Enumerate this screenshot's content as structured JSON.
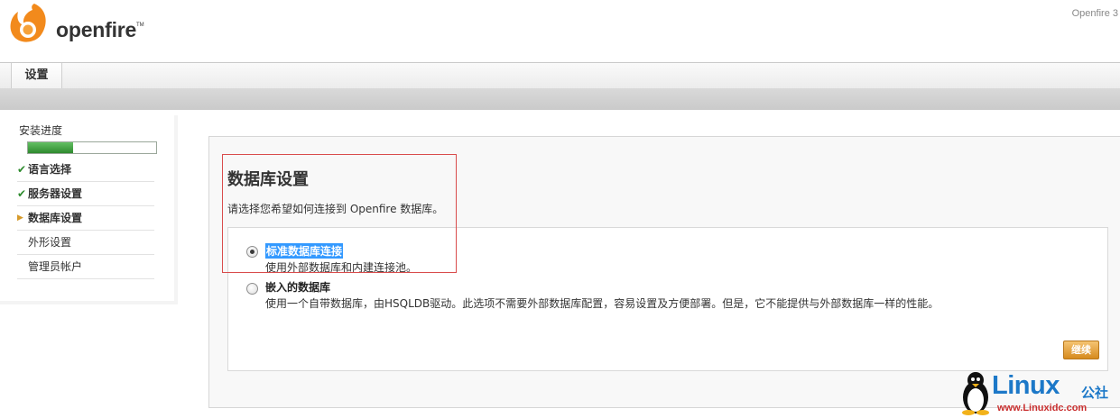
{
  "header": {
    "brand": "openfire",
    "brand_tm": "TM",
    "version": "Openfire 3"
  },
  "tabs": [
    {
      "label": "设置"
    }
  ],
  "sidebar": {
    "progress_label": "安装进度",
    "progress_value": 0.35,
    "steps": [
      {
        "label": "语言选择",
        "state": "done"
      },
      {
        "label": "服务器设置",
        "state": "done"
      },
      {
        "label": "数据库设置",
        "state": "current"
      },
      {
        "label": "外形设置",
        "state": "pending"
      },
      {
        "label": "管理员帐户",
        "state": "pending"
      }
    ]
  },
  "main": {
    "title": "数据库设置",
    "description": "请选择您希望如何连接到 Openfire 数据库。",
    "options": [
      {
        "title": "标准数据库连接",
        "desc": "使用外部数据库和内建连接池。",
        "selected": true
      },
      {
        "title": "嵌入的数据库",
        "desc": "使用一个自带数据库，由HSQLDB驱动。此选项不需要外部数据库配置，容易设置及方便部署。但是，它不能提供与外部数据库一样的性能。",
        "selected": false
      }
    ],
    "continue_label": "继续"
  },
  "watermark": {
    "text": "Linux",
    "cn": "公社",
    "url": "www.Linuxidc.com"
  },
  "colors": {
    "accent_orange": "#d68a1e",
    "progress_green": "#2f8a2f",
    "selection_blue": "#3399ff",
    "highlight_red": "#d94c4c"
  }
}
